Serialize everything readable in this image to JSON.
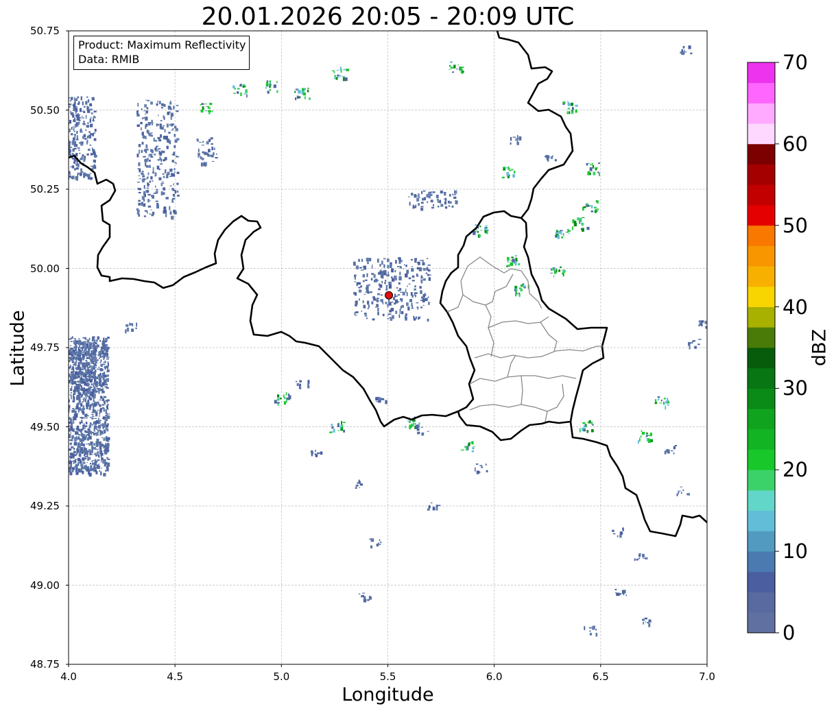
{
  "title": "20.01.2026 20:05 - 20:09 UTC",
  "info_box": {
    "line1": "Product: Maximum Reflectivity",
    "line2": "Data: RMIB"
  },
  "axes": {
    "xlabel": "Longitude",
    "ylabel": "Latitude",
    "xlim": [
      4.0,
      7.0
    ],
    "ylim": [
      48.75,
      50.75
    ],
    "xticks": [
      "4.0",
      "4.5",
      "5.0",
      "5.5",
      "6.0",
      "6.5",
      "7.0"
    ],
    "yticks": [
      "50.75",
      "50.50",
      "50.25",
      "50.00",
      "49.75",
      "49.50",
      "49.25",
      "49.00",
      "48.75"
    ],
    "grid": true
  },
  "radar_site": {
    "lon": 5.505,
    "lat": 49.915,
    "color": "#e01010"
  },
  "colorbar": {
    "label": "dBZ",
    "ticks": [
      "0",
      "10",
      "20",
      "30",
      "40",
      "50",
      "60",
      "70"
    ],
    "range": [
      0,
      70
    ],
    "step": 2.5,
    "colors": [
      "#6070a0",
      "#586aa0",
      "#4a5ea0",
      "#4a7ab0",
      "#529ac0",
      "#62bed8",
      "#62d6c8",
      "#3cd26a",
      "#18c82a",
      "#12b424",
      "#10a41e",
      "#0a8a16",
      "#087612",
      "#065c0a",
      "#4a7a08",
      "#a8b000",
      "#f8d400",
      "#f8b000",
      "#f89600",
      "#f87800",
      "#e40000",
      "#c20000",
      "#a40000",
      "#7c0000",
      "#ffd8ff",
      "#ffaaff",
      "#ff66ff",
      "#ee33ee"
    ]
  },
  "map_features": [
    "country-borders",
    "luxembourg-cantons",
    "radar-echoes"
  ],
  "colors": {
    "border": "#000000",
    "cantons": "#888888",
    "grid": "#bbbbbb"
  }
}
